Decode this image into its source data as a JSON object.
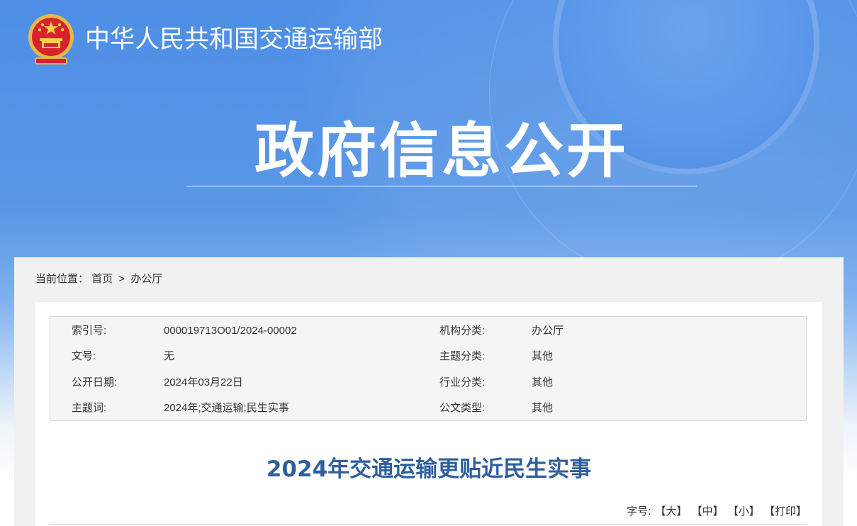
{
  "header": {
    "site_name": "中华人民共和国交通运输部",
    "section_title": "政府信息公开"
  },
  "breadcrumb": {
    "label": "当前位置：",
    "home": "首页",
    "separator": ">",
    "current": "办公厅"
  },
  "meta": {
    "rows": [
      {
        "k1": "索引号:",
        "v1": "000019713O01/2024-00002",
        "k2": "机构分类:",
        "v2": "办公厅"
      },
      {
        "k1": "文号:",
        "v1": "无",
        "k2": "主题分类:",
        "v2": "其他"
      },
      {
        "k1": "公开日期:",
        "v1": "2024年03月22日",
        "k2": "行业分类:",
        "v2": "其他"
      },
      {
        "k1": "主题词:",
        "v1": "2024年;交通运输;民生实事",
        "k2": "公文类型:",
        "v2": "其他"
      }
    ]
  },
  "article": {
    "title": "2024年交通运输更贴近民生实事"
  },
  "font_size": {
    "label": "字号:",
    "large": "【大】",
    "medium": "【中】",
    "small": "【小】",
    "print": "【打印】"
  },
  "colors": {
    "hero_blue": "#4d8ee6",
    "title_blue": "#2e5f9e",
    "panel_gray": "#f1f1f1"
  }
}
